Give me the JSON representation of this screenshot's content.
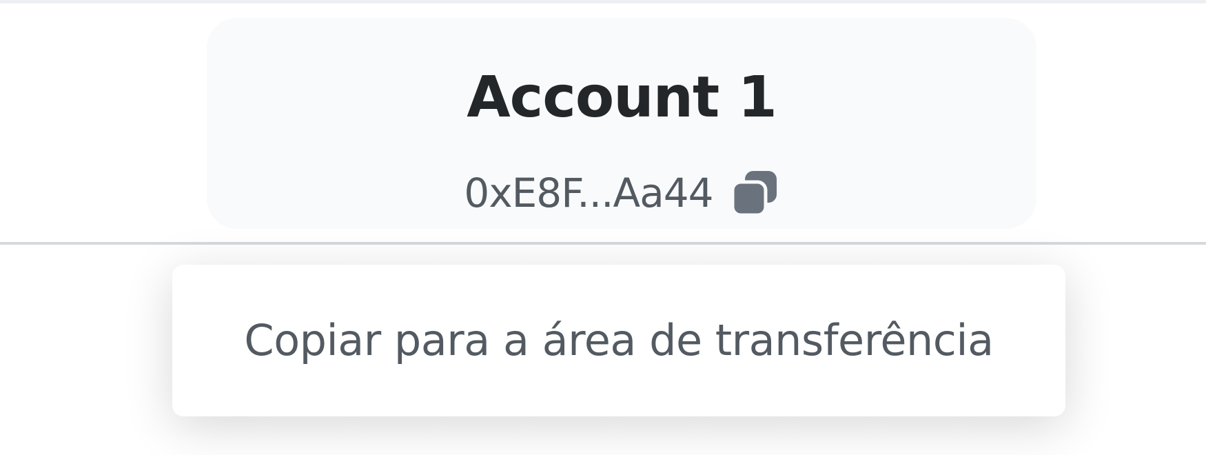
{
  "account": {
    "name": "Account 1",
    "address_short": "0xE8F...Aa44",
    "copy_icon": "copy-icon"
  },
  "tooltip": {
    "text": "Copiar para a área de transferência"
  },
  "colors": {
    "card_background": "#f9fafb",
    "title_text": "#24272a",
    "secondary_text": "#535a61",
    "icon": "#6a737d",
    "divider": "#d6d9dc"
  }
}
